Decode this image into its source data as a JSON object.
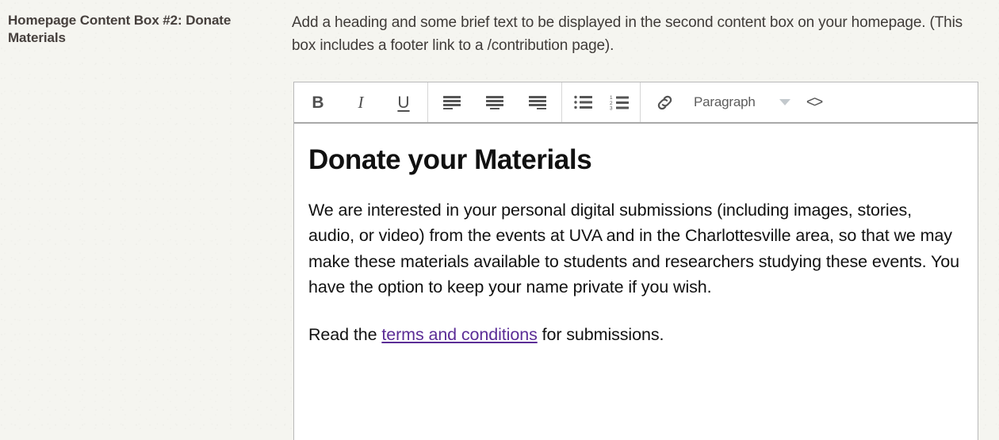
{
  "field": {
    "label": "Homepage Content Box #2: Donate Materials",
    "description": "Add a heading and some brief text to be displayed in the second content box on your homepage. (This box includes a footer link to a /contribution page)."
  },
  "editor": {
    "toolbar": {
      "bold_label": "B",
      "italic_label": "I",
      "underline_label": "U",
      "align_left_name": "align-left",
      "align_center_name": "align-center",
      "align_right_name": "align-right",
      "bullet_list_name": "bulleted-list",
      "numbered_list_name": "numbered-list",
      "link_name": "link",
      "format_select_value": "Paragraph",
      "format_select_options": [
        "Paragraph"
      ],
      "source_code_label": "<>"
    },
    "content": {
      "heading": "Donate your Materials",
      "paragraph_1": "We are interested in your personal digital submissions (including images, stories, audio, or video) from the events at UVA and in the Charlottesville area, so that we may make these materials available to students and researchers studying these events. You have the option to keep your name private if you wish.",
      "paragraph_2_before": "Read the ",
      "paragraph_2_link": "terms and conditions",
      "paragraph_2_after": " for submissions."
    }
  },
  "colors": {
    "page_background": "#f5f5f0",
    "label_text": "#46403d",
    "body_text": "#111111",
    "link": "#5b2d96",
    "toolbar_icon": "#4f4f4f",
    "editor_border": "#b9b9b9",
    "caret": "#c3c9cd"
  }
}
